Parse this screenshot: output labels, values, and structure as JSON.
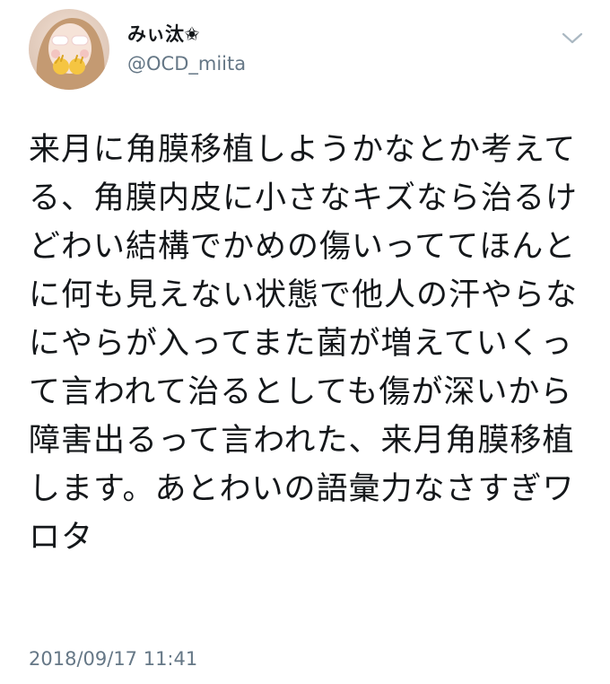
{
  "user": {
    "display_name": "みぃ汰✬",
    "handle": "@OCD_miita",
    "avatar_icon": "profile-photo-avatar"
  },
  "tweet": {
    "text": "来月に角膜移植しようかなとか考えてる、角膜内皮に小さなキズなら治るけどわい結構でかめの傷いっててほんとに何も見えない状態で他人の汗やらなにやらが入ってまた菌が増えていくって言われて治るとしても傷が深いから障害出るって言われた、来月角膜移植します。あとわいの語彙力なさすぎワロタ",
    "timestamp": "2018/09/17 11:41"
  },
  "menu": {
    "icon": "chevron-down-icon"
  },
  "colors": {
    "text_primary": "#14171a",
    "text_secondary": "#657786",
    "chevron": "#aab8c2",
    "background": "#ffffff"
  }
}
